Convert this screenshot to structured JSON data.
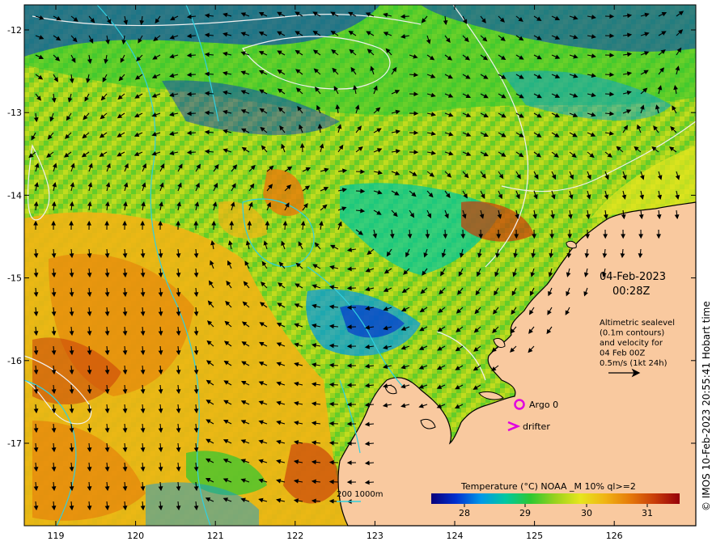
{
  "map": {
    "timestamp": {
      "date": "04-Feb-2023",
      "time": "00:28Z"
    },
    "info_lines": [
      "Altimetric sealevel",
      "(0.1m contours)",
      "and velocity for",
      "04 Feb 00Z",
      "0.5m/s (1kt 24h)"
    ],
    "legend": {
      "argo_label": "Argo 0",
      "drifter_label": "drifter"
    },
    "depth_label": "200  1000m",
    "colorbar": {
      "title": "Temperature (°C) NOAA _M 10% ql>=2",
      "ticks": [
        "28",
        "29",
        "30",
        "31"
      ],
      "colors": [
        "#08007a",
        "#0030d0",
        "#0098e8",
        "#00c8a0",
        "#2ec832",
        "#9ad21e",
        "#e6e61e",
        "#f0b414",
        "#e67a0a",
        "#c83c0a",
        "#96000a"
      ]
    },
    "x_ticks": [
      "119",
      "120",
      "121",
      "122",
      "123",
      "124",
      "125",
      "126"
    ],
    "y_ticks": [
      "-12",
      "-13",
      "-14",
      "-15",
      "-16",
      "-17"
    ],
    "land_color": "#f9c99f",
    "contour_colors": {
      "sealevel": "#f0f0f0",
      "isobath": "#30d0e0"
    }
  },
  "credit": "© IMOS 10-Feb-2023 20:55:41 Hobart time"
}
